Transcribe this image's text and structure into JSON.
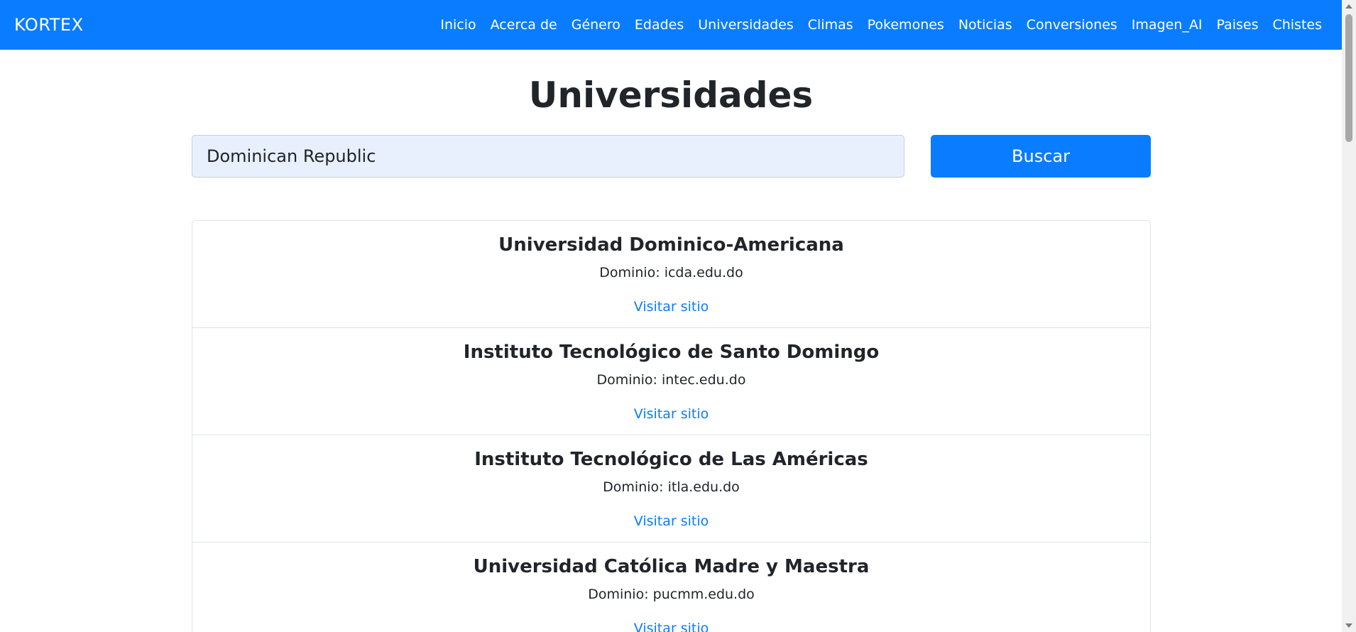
{
  "navbar": {
    "brand": "KORTEX",
    "links": [
      {
        "label": "Inicio"
      },
      {
        "label": "Acerca de"
      },
      {
        "label": "Género"
      },
      {
        "label": "Edades"
      },
      {
        "label": "Universidades"
      },
      {
        "label": "Climas"
      },
      {
        "label": "Pokemones"
      },
      {
        "label": "Noticias"
      },
      {
        "label": "Conversiones"
      },
      {
        "label": "Imagen_AI"
      },
      {
        "label": "Paises"
      },
      {
        "label": "Chistes"
      }
    ]
  },
  "main": {
    "title": "Universidades",
    "search": {
      "value": "Dominican Republic",
      "button_label": "Buscar"
    },
    "results": [
      {
        "name": "Universidad Dominico-Americana",
        "domain": "Dominio: icda.edu.do",
        "link": "Visitar sitio"
      },
      {
        "name": "Instituto Tecnológico de Santo Domingo",
        "domain": "Dominio: intec.edu.do",
        "link": "Visitar sitio"
      },
      {
        "name": "Instituto Tecnológico de Las Américas",
        "domain": "Dominio: itla.edu.do",
        "link": "Visitar sitio"
      },
      {
        "name": "Universidad Católica Madre y Maestra",
        "domain": "Dominio: pucmm.edu.do",
        "link": "Visitar sitio"
      }
    ]
  },
  "colors": {
    "primary": "#0a7cff",
    "input_bg": "#e8f0fe",
    "text": "#212529"
  }
}
